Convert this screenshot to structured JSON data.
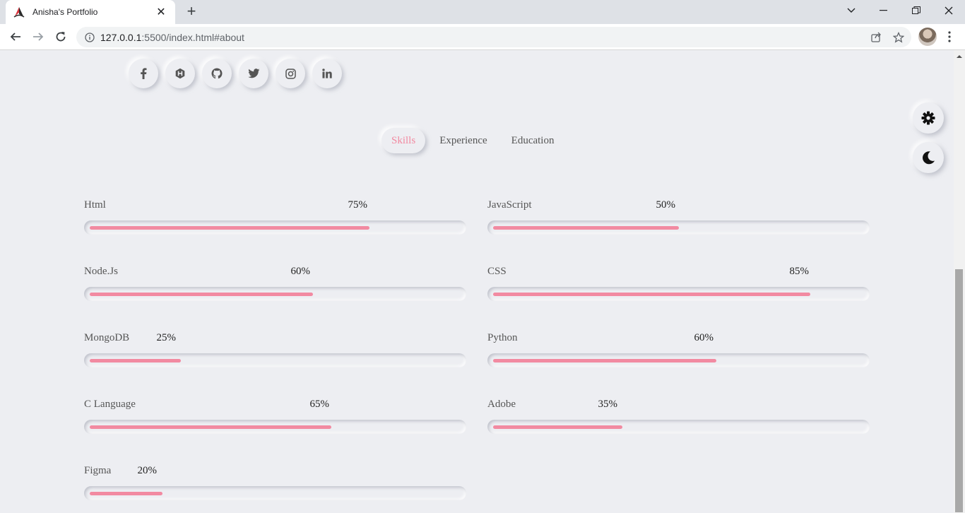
{
  "browser": {
    "tab_title": "Anisha's Portfolio",
    "url_host": "127.0.0.1",
    "url_rest": ":5500/index.html#about"
  },
  "colors": {
    "accent": "#f28aa1",
    "page_bg": "#edeef2",
    "text": "#555555"
  },
  "social_icons": [
    "facebook-icon",
    "hashnode-icon",
    "github-icon",
    "twitter-icon",
    "instagram-icon",
    "linkedin-icon"
  ],
  "tabs": [
    {
      "label": "Skills",
      "active": true
    },
    {
      "label": "Experience",
      "active": false
    },
    {
      "label": "Education",
      "active": false
    }
  ],
  "skills": [
    {
      "name": "Html",
      "percent_label": "75%",
      "value": 75
    },
    {
      "name": "JavaScript",
      "percent_label": "50%",
      "value": 50
    },
    {
      "name": "Node.Js",
      "percent_label": "60%",
      "value": 60
    },
    {
      "name": "CSS",
      "percent_label": "85%",
      "value": 85
    },
    {
      "name": "MongoDB",
      "percent_label": "25%",
      "value": 25
    },
    {
      "name": "Python",
      "percent_label": "60%",
      "value": 60
    },
    {
      "name": "C Language",
      "percent_label": "65%",
      "value": 65
    },
    {
      "name": "Adobe",
      "percent_label": "35%",
      "value": 35
    },
    {
      "name": "Figma",
      "percent_label": "20%",
      "value": 20
    }
  ]
}
